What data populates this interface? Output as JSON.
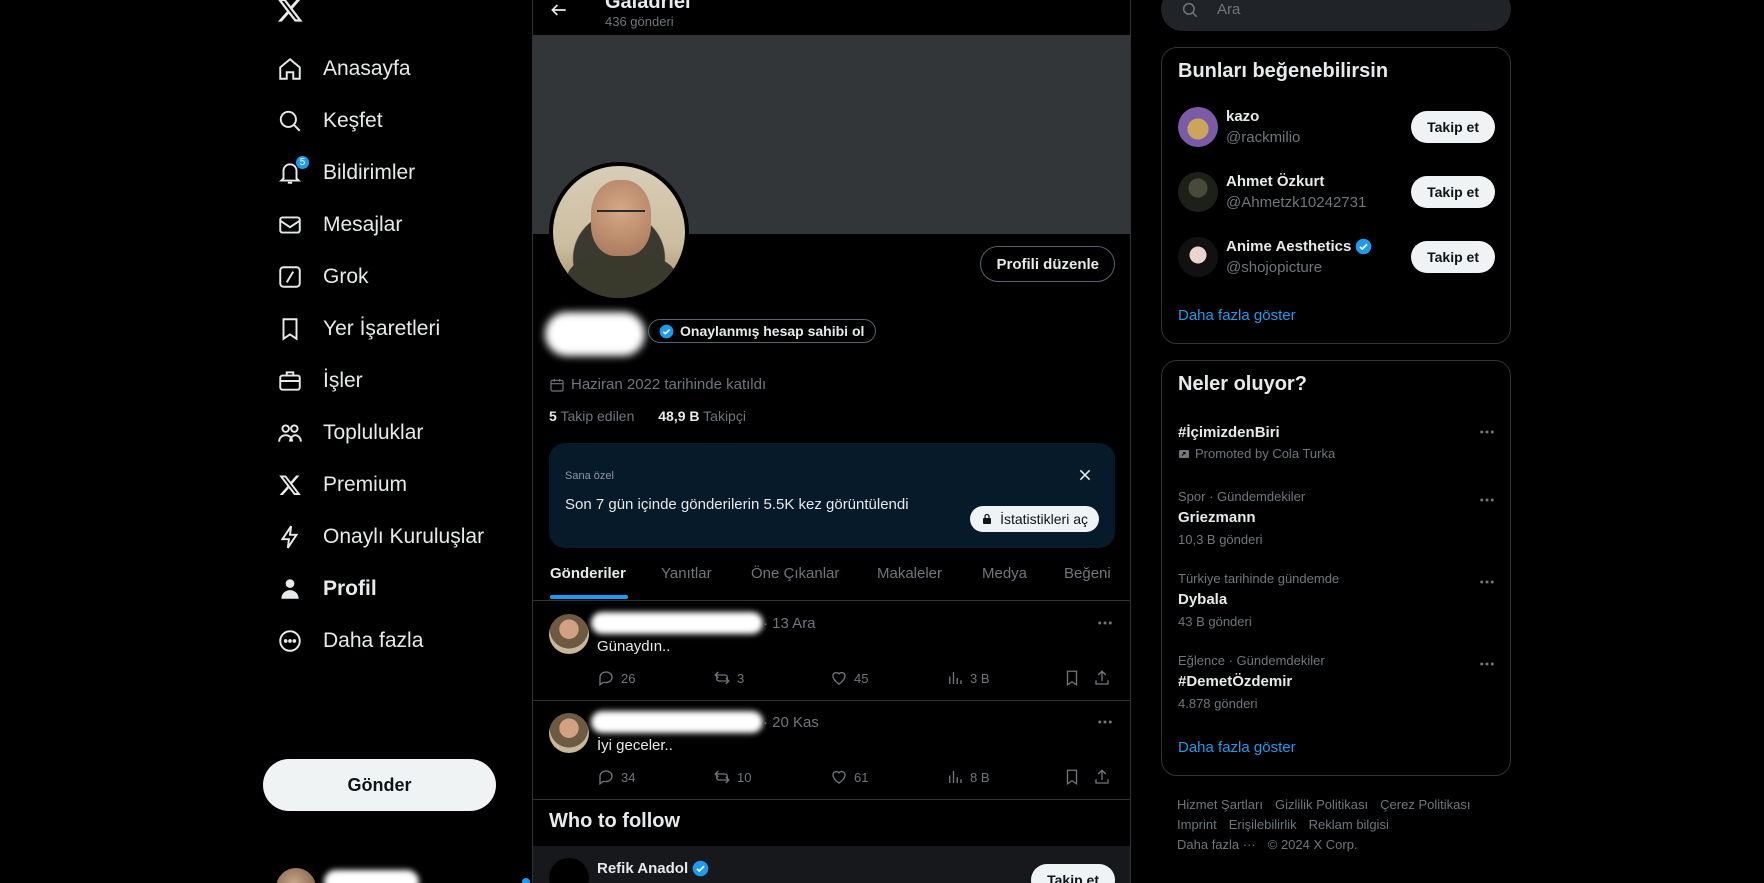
{
  "nav": {
    "items": [
      {
        "label": "Anasayfa",
        "icon": "home-icon"
      },
      {
        "label": "Keşfet",
        "icon": "search-icon"
      },
      {
        "label": "Bildirimler",
        "icon": "bell-icon",
        "badge": "5"
      },
      {
        "label": "Mesajlar",
        "icon": "envelope-icon"
      },
      {
        "label": "Grok",
        "icon": "grok-icon"
      },
      {
        "label": "Yer İşaretleri",
        "icon": "bookmark-icon"
      },
      {
        "label": "İşler",
        "icon": "briefcase-icon"
      },
      {
        "label": "Topluluklar",
        "icon": "people-icon"
      },
      {
        "label": "Premium",
        "icon": "x-logo-icon"
      },
      {
        "label": "Onaylı Kuruluşlar",
        "icon": "lightning-icon"
      },
      {
        "label": "Profil",
        "icon": "person-icon"
      },
      {
        "label": "Daha fazla",
        "icon": "more-circle-icon"
      }
    ],
    "post_button": "Gönder"
  },
  "header": {
    "name": "Galadriel",
    "post_count": "436 gönderi"
  },
  "profile": {
    "edit_button": "Profili düzenle",
    "verify_pill": "Onaylanmış hesap sahibi ol",
    "handle_prefix": "@",
    "joined": "Haziran 2022 tarihinde katıldı",
    "following_count": "5",
    "following_label": "Takip edilen",
    "followers_count": "48,9 B",
    "followers_label": "Takipçi"
  },
  "promo": {
    "kicker": "Sana özel",
    "message": "Son 7 gün içinde gönderilerin 5.5K kez görüntülendi",
    "button": "İstatistikleri aç"
  },
  "tabs": [
    "Gönderiler",
    "Yanıtlar",
    "Öne Çıkanlar",
    "Makaleler",
    "Medya",
    "Beğeni"
  ],
  "tweets": [
    {
      "date": "· 13 Ara",
      "text": "Günaydın..",
      "replies": "26",
      "retweets": "3",
      "likes": "45",
      "views": "3 B"
    },
    {
      "date": "· 20 Kas",
      "text": "İyi geceler..",
      "replies": "34",
      "retweets": "10",
      "likes": "61",
      "views": "8 B"
    }
  ],
  "who_to_follow": {
    "title": "Who to follow",
    "name": "Refik Anadol",
    "button": "Takip et"
  },
  "sidebar": {
    "search_placeholder": "Ara",
    "suggestions_title": "Bunları beğenebilirsin",
    "suggestions": [
      {
        "name": "kazo",
        "handle": "@rackmilio",
        "verified": false,
        "button": "Takip et"
      },
      {
        "name": "Ahmet Özkurt",
        "handle": "@Ahmetzk10242731",
        "verified": false,
        "button": "Takip et"
      },
      {
        "name": "Anime Aesthetics",
        "handle": "@shojopicture",
        "verified": true,
        "button": "Takip et"
      }
    ],
    "show_more": "Daha fazla göster",
    "trends_title": "Neler oluyor?",
    "trends": [
      {
        "meta": "",
        "title": "#İçimizdenBiri",
        "sub": "Promoted by Cola Turka",
        "promoted": true
      },
      {
        "meta": "Spor · Gündemdekiler",
        "title": "Griezmann",
        "sub": "10,3 B gönderi",
        "promoted": false
      },
      {
        "meta": "Türkiye tarihinde gündemde",
        "title": "Dybala",
        "sub": "43 B gönderi",
        "promoted": false
      },
      {
        "meta": "Eğlence · Gündemdekiler",
        "title": "#DemetÖzdemir",
        "sub": "4.878 gönderi",
        "promoted": false
      }
    ],
    "trends_more": "Daha fazla göster",
    "footer": [
      "Hizmet Şartları",
      "Gizlilik Politikası",
      "Çerez Politikası",
      "Imprint",
      "Erişilebilirlik",
      "Reklam bilgisi",
      "Daha fazla ···",
      "© 2024 X Corp."
    ]
  },
  "colors": {
    "accent": "#1d9bf0",
    "background": "#000000",
    "border": "#2f3336",
    "muted": "#71767b"
  }
}
